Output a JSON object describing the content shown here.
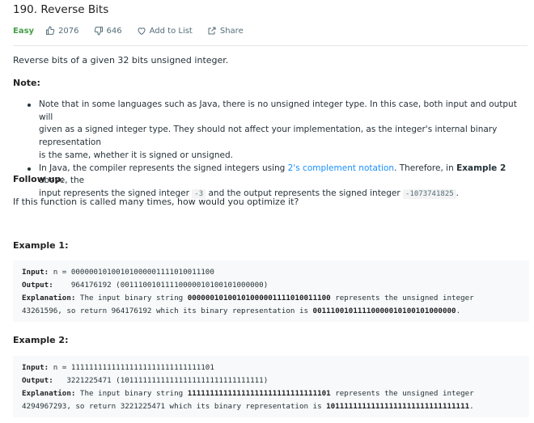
{
  "problem": {
    "title": "190. Reverse Bits",
    "difficulty": "Easy",
    "likes": "2076",
    "dislikes": "646",
    "add_to_list": "Add to List",
    "share": "Share"
  },
  "description": "Reverse bits of a given 32 bits unsigned integer.",
  "note_heading": "Note:",
  "notes": [
    {
      "line1": "Note that in some languages such as Java, there is no unsigned integer type. In this case, both input and output will",
      "line2": "given as a signed integer type. They should not affect your implementation, as the integer's internal binary representation",
      "line3": "is the same, whether it is signed or unsigned."
    },
    {
      "pre_link": "In Java, the compiler represents the signed integers using ",
      "link": "2's complement notation",
      "after_link": ". Therefore, in ",
      "bold": "Example 2",
      "after_bold": " above, the",
      "line2_a": "input represents the signed integer ",
      "code1": "-3",
      "line2_b": " and the output represents the signed integer ",
      "code2": "-1073741825",
      "line2_c": "."
    }
  ],
  "followup_heading": "Follow up",
  "followup_colon": ":",
  "followup_text": "If this function is called many times, how would you optimize it?",
  "examples": [
    {
      "heading": "Example 1:",
      "input_label": "Input:",
      "input_value": " n = 00000010100101000001111010011100",
      "output_label": "Output:",
      "output_value": "    964176192 (00111001011110000010100101000000)",
      "explanation_label": "Explanation:",
      "explanation_pre": " The input binary string ",
      "explanation_bin": "00000010100101000001111010011100",
      "explanation_post": " represents the unsigned integer",
      "explanation_line2_pre": "43261596, so return 964176192 which its binary representation is ",
      "explanation_line2_bin": "00111001011110000010100101000000",
      "explanation_line2_end": "."
    },
    {
      "heading": "Example 2:",
      "input_label": "Input:",
      "input_value": " n = 11111111111111111111111111111101",
      "output_label": "Output:",
      "output_value": "   3221225471 (10111111111111111111111111111111)",
      "explanation_label": "Explanation:",
      "explanation_pre": " The input binary string ",
      "explanation_bin": "11111111111111111111111111111101",
      "explanation_post": " represents the unsigned integer",
      "explanation_line2_pre": "4294967293, so return 3221225471 which its binary representation is ",
      "explanation_line2_bin": "10111111111111111111111111111111",
      "explanation_line2_end": "."
    }
  ],
  "icons": {
    "like": "thumbs-up-icon",
    "dislike": "thumbs-down-icon",
    "add": "heart-icon",
    "share": "share-icon"
  },
  "colors": {
    "easy": "#43a047",
    "link": "#1a90ff",
    "code_bg": "#f7f9fa"
  }
}
